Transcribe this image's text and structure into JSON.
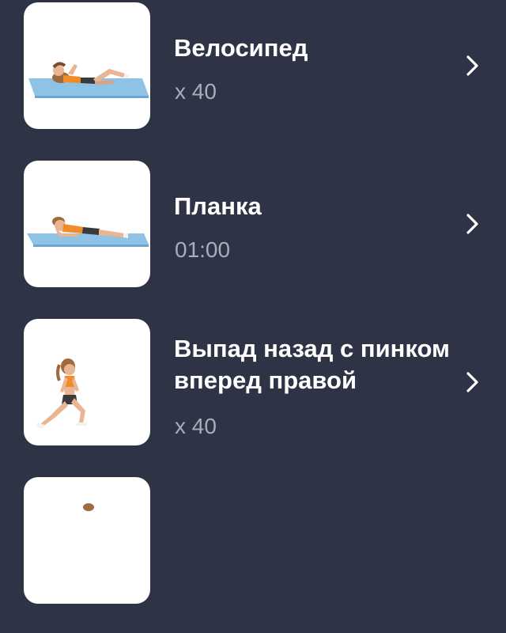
{
  "exercises": [
    {
      "name": "Велосипед",
      "detail": "x 40",
      "image": "bicycle-crunch-illustration",
      "icon": "chevron-right-icon"
    },
    {
      "name": "Планка",
      "detail": "01:00",
      "image": "plank-illustration",
      "icon": "chevron-right-icon"
    },
    {
      "name": "Выпад назад с пинком вперед правой",
      "detail": "x 40",
      "image": "reverse-lunge-kick-illustration",
      "icon": "chevron-right-icon"
    },
    {
      "name": "",
      "detail": "",
      "image": "exercise-illustration",
      "icon": ""
    }
  ],
  "colors": {
    "background": "#2f3346",
    "title": "#ffffff",
    "detail": "#a9acba",
    "mat": "#8fc3e6",
    "top": "#f28c28"
  }
}
